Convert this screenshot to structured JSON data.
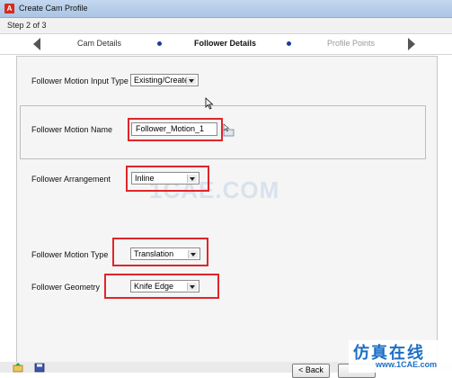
{
  "window": {
    "title": "Create Cam Profile"
  },
  "wizard": {
    "step_text": "Step 2 of 3",
    "tabs": [
      {
        "label": "Cam Details",
        "state": "done"
      },
      {
        "label": "Follower Details",
        "state": "current"
      },
      {
        "label": "Profile Points",
        "state": "upcoming"
      }
    ]
  },
  "form": {
    "input_type": {
      "label": "Follower Motion Input Type",
      "value": "Existing/Create"
    },
    "motion_name": {
      "label": "Follower Motion Name",
      "value": "Follower_Motion_1"
    },
    "arrangement": {
      "label": "Follower Arrangement",
      "value": "Inline"
    },
    "motion_type": {
      "label": "Follower Motion Type",
      "value": "Translation"
    },
    "geometry": {
      "label": "Follower Geometry",
      "value": "Knife Edge"
    }
  },
  "footer": {
    "back_label": "< Back"
  },
  "watermark": {
    "text": "1CAE.COM",
    "logo_text": "仿真在线",
    "logo_url": "www.1CAE.com"
  },
  "colors": {
    "highlight": "#e0252b",
    "accent": "#1a3c9a",
    "logo": "#1c6fc4"
  },
  "icons": {
    "app": "app-icon",
    "picker": "entity-picker-icon",
    "nav_prev": "arrow-left-icon",
    "nav_next": "arrow-right-icon"
  }
}
